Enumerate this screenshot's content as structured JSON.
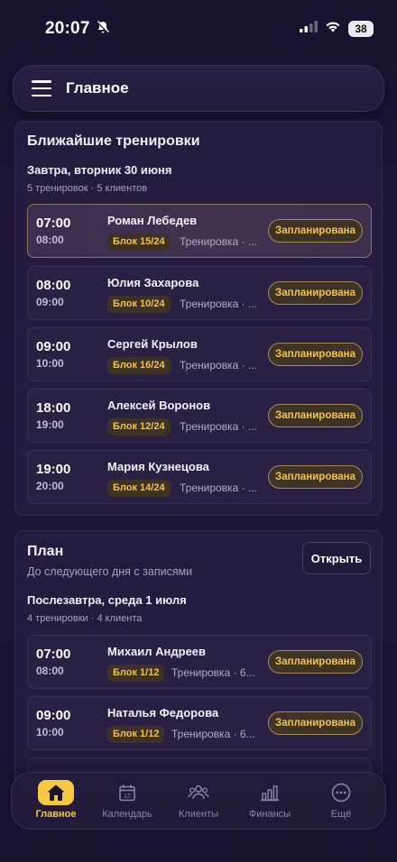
{
  "status_bar": {
    "time": "20:07",
    "battery": "38"
  },
  "header": {
    "title": "Главное"
  },
  "upcoming": {
    "title": "Ближайшие тренировки",
    "day_title": "Завтра, вторник 30 июня",
    "day_summary": "5 тренировок · 5 клиентов",
    "sessions": [
      {
        "start": "07:00",
        "end": "08:00",
        "client": "Роман Лебедев",
        "block": "Блок 15/24",
        "type": "Тренировка · ...",
        "status": "Запланирована"
      },
      {
        "start": "08:00",
        "end": "09:00",
        "client": "Юлия Захарова",
        "block": "Блок 10/24",
        "type": "Тренировка · ...",
        "status": "Запланирована"
      },
      {
        "start": "09:00",
        "end": "10:00",
        "client": "Сергей Крылов",
        "block": "Блок 16/24",
        "type": "Тренировка · ...",
        "status": "Запланирована"
      },
      {
        "start": "18:00",
        "end": "19:00",
        "client": "Алексей Воронов",
        "block": "Блок 12/24",
        "type": "Тренировка · ...",
        "status": "Запланирована"
      },
      {
        "start": "19:00",
        "end": "20:00",
        "client": "Мария Кузнецова",
        "block": "Блок 14/24",
        "type": "Тренировка · ...",
        "status": "Запланирована"
      }
    ]
  },
  "plan": {
    "title": "План",
    "subtitle": "До следующего дня с записями",
    "open_label": "Открыть",
    "day_title": "Послезавтра, среда 1 июля",
    "day_summary": "4 тренировки · 4 клиента",
    "sessions": [
      {
        "start": "07:00",
        "end": "08:00",
        "client": "Михаил Андреев",
        "block": "Блок 1/12",
        "type": "Тренировка · 6...",
        "status": "Запланирована"
      },
      {
        "start": "09:00",
        "end": "10:00",
        "client": "Наталья Федорова",
        "block": "Блок 1/12",
        "type": "Тренировка · 6...",
        "status": "Запланирована"
      }
    ]
  },
  "tabbar": {
    "items": [
      {
        "label": "Главное",
        "icon": "home-icon"
      },
      {
        "label": "Календарь",
        "icon": "calendar-icon"
      },
      {
        "label": "Клиенты",
        "icon": "clients-icon"
      },
      {
        "label": "Финансы",
        "icon": "finance-icon"
      },
      {
        "label": "Ещё",
        "icon": "more-icon"
      }
    ]
  },
  "colors": {
    "accent": "#f5c842",
    "background": "#1f1538",
    "card": "#251b3e"
  }
}
